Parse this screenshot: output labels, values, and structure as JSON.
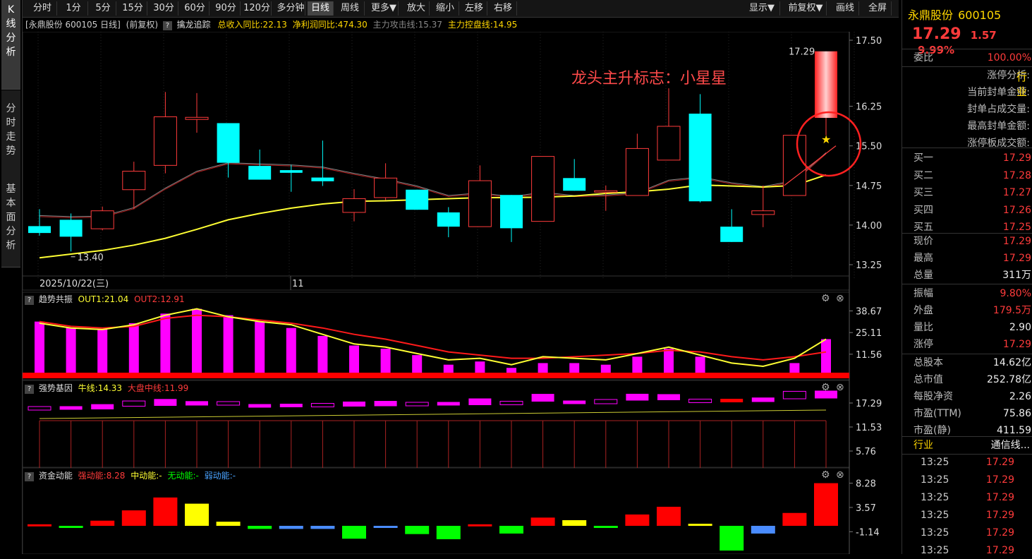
{
  "sidebar": {
    "tabs": [
      {
        "label": "K线分析",
        "chars": [
          "K",
          "线",
          "分",
          "析"
        ]
      },
      {
        "label": "分时走势",
        "chars": [
          "分",
          "时",
          "走",
          "势"
        ]
      },
      {
        "label": "基本面分析",
        "chars": [
          "基",
          "本",
          "面",
          "分",
          "析"
        ]
      }
    ]
  },
  "toolbar": {
    "periods": [
      "分时",
      "1分",
      "5分",
      "15分",
      "30分",
      "60分",
      "90分",
      "120分",
      "多分钟",
      "日线",
      "周线",
      "更多▼",
      "放大",
      "缩小",
      "左移",
      "右移"
    ],
    "selected": "日线",
    "right": [
      "显示▼",
      "前复权▼",
      "画线",
      "全屏"
    ]
  },
  "chart_header": {
    "stock": "[永鼎股份 600105 日线]",
    "adjust": "(前复权)",
    "indicator": "擒龙追踪",
    "revenue": "总收入同比:22.13",
    "profit": "净利润同比:474.30",
    "attack": "主力攻击线:15.37",
    "control": "主力控盘线:14.95"
  },
  "main_chart": {
    "y_ticks": [
      "17.50",
      "16.25",
      "15.50",
      "14.75",
      "14.00",
      "13.25"
    ],
    "last_price_label": "17.29",
    "low_label": "13.40",
    "date_label": "2025/10/22(三)",
    "month_label": "11",
    "annotation": "龙头主升标志：小星星",
    "candles": [
      {
        "o": 13.98,
        "c": 13.85,
        "h": 14.3,
        "l": 13.8
      },
      {
        "o": 14.1,
        "c": 13.78,
        "h": 14.22,
        "l": 13.5
      },
      {
        "o": 13.93,
        "c": 14.27,
        "h": 14.35,
        "l": 13.9
      },
      {
        "o": 14.67,
        "c": 15.02,
        "h": 15.2,
        "l": 14.3
      },
      {
        "o": 15.13,
        "c": 16.05,
        "h": 16.52,
        "l": 14.98
      },
      {
        "o": 16.0,
        "c": 16.04,
        "h": 16.5,
        "l": 15.75
      },
      {
        "o": 15.93,
        "c": 15.18,
        "h": 15.93,
        "l": 14.9
      },
      {
        "o": 15.12,
        "c": 14.86,
        "h": 15.43,
        "l": 14.86
      },
      {
        "o": 15.04,
        "c": 14.99,
        "h": 15.14,
        "l": 14.63
      },
      {
        "o": 14.9,
        "c": 14.83,
        "h": 15.6,
        "l": 14.74
      },
      {
        "o": 14.24,
        "c": 14.5,
        "h": 14.68,
        "l": 14.07
      },
      {
        "o": 14.52,
        "c": 14.89,
        "h": 15.17,
        "l": 14.47
      },
      {
        "o": 14.67,
        "c": 14.29,
        "h": 14.67,
        "l": 14.29
      },
      {
        "o": 14.24,
        "c": 13.97,
        "h": 14.34,
        "l": 13.77
      },
      {
        "o": 13.97,
        "c": 14.84,
        "h": 15.13,
        "l": 13.97
      },
      {
        "o": 14.57,
        "c": 13.94,
        "h": 14.57,
        "l": 13.68
      },
      {
        "o": 14.07,
        "c": 15.3,
        "h": 15.3,
        "l": 14.07
      },
      {
        "o": 14.89,
        "c": 14.65,
        "h": 15.25,
        "l": 14.65
      },
      {
        "o": 14.65,
        "c": 14.65,
        "h": 14.75,
        "l": 14.27
      },
      {
        "o": 14.56,
        "c": 15.45,
        "h": 15.73,
        "l": 14.56
      },
      {
        "o": 15.23,
        "c": 15.87,
        "h": 16.59,
        "l": 15.23
      },
      {
        "o": 16.11,
        "c": 14.45,
        "h": 16.48,
        "l": 14.43
      },
      {
        "o": 13.97,
        "c": 13.68,
        "h": 14.3,
        "l": 13.68
      },
      {
        "o": 14.2,
        "c": 14.27,
        "h": 14.75,
        "l": 13.96
      },
      {
        "o": 14.56,
        "c": 15.7,
        "h": 15.7,
        "l": 14.56
      },
      {
        "o": 16.03,
        "c": 17.29,
        "h": 17.29,
        "l": 15.7
      }
    ],
    "ma_fast": [
      14.18,
      14.16,
      14.17,
      14.33,
      14.7,
      15.02,
      15.18,
      15.16,
      15.14,
      15.1,
      14.98,
      14.87,
      14.74,
      14.56,
      14.61,
      14.54,
      14.62,
      14.56,
      14.57,
      14.61,
      14.85,
      14.91,
      14.8,
      14.73,
      14.84,
      15.37
    ],
    "ma_control": [
      13.38,
      13.45,
      13.52,
      13.62,
      13.75,
      13.92,
      14.1,
      14.22,
      14.32,
      14.4,
      14.45,
      14.46,
      14.48,
      14.5,
      14.52,
      14.52,
      14.53,
      14.55,
      14.6,
      14.63,
      14.68,
      14.76,
      14.74,
      14.72,
      14.75,
      14.95
    ]
  },
  "panel2": {
    "title": "趋势共振",
    "out1": "OUT1:21.04",
    "out2": "OUT2:12.91",
    "y_ticks": [
      "38.67",
      "25.11",
      "11.56"
    ],
    "bars": [
      32,
      28,
      27,
      31,
      37,
      40,
      36,
      32,
      28,
      23,
      17,
      15,
      11,
      5,
      7,
      3,
      6,
      6,
      5,
      10,
      15,
      10,
      0,
      0,
      6,
      21
    ],
    "out1_line": [
      31,
      28,
      27,
      30,
      36,
      40,
      35,
      32,
      30,
      24,
      18,
      16,
      12,
      8,
      9,
      5,
      10,
      9,
      8,
      12,
      16,
      11,
      6,
      4,
      9,
      21
    ],
    "out2_line": [
      32,
      29,
      28,
      29,
      34,
      36,
      35,
      33,
      31,
      28,
      24,
      21,
      17,
      13,
      11,
      9,
      9,
      10,
      11,
      12,
      14,
      13,
      10,
      8,
      10,
      13
    ]
  },
  "panel3": {
    "title": "强势基因",
    "niu": "牛线:14.33",
    "dapan": "大盘中线:11.99",
    "y_ticks": [
      "17.29",
      "11.53",
      "5.76"
    ]
  },
  "panel4": {
    "title": "资金动能",
    "strong": "强动能:8.28",
    "mid": "中动能:-",
    "none": "无动能:-",
    "weak": "弱动能:-",
    "y_ticks": [
      "8.28",
      "3.57",
      "-1.14"
    ],
    "bars": [
      {
        "v": 0.3,
        "c": "red"
      },
      {
        "v": -0.4,
        "c": "green"
      },
      {
        "v": 1.0,
        "c": "red"
      },
      {
        "v": 3.0,
        "c": "red"
      },
      {
        "v": 5.5,
        "c": "red"
      },
      {
        "v": 4.3,
        "c": "yellow"
      },
      {
        "v": 0.8,
        "c": "yellow"
      },
      {
        "v": -0.6,
        "c": "green"
      },
      {
        "v": -0.6,
        "c": "blue"
      },
      {
        "v": -0.6,
        "c": "blue"
      },
      {
        "v": -2.5,
        "c": "green"
      },
      {
        "v": -0.3,
        "c": "blue"
      },
      {
        "v": -1.6,
        "c": "green"
      },
      {
        "v": -2.6,
        "c": "green"
      },
      {
        "v": 0.3,
        "c": "red"
      },
      {
        "v": -1.5,
        "c": "green"
      },
      {
        "v": 1.6,
        "c": "red"
      },
      {
        "v": 1.1,
        "c": "yellow"
      },
      {
        "v": -0.3,
        "c": "green"
      },
      {
        "v": 2.2,
        "c": "red"
      },
      {
        "v": 3.7,
        "c": "red"
      },
      {
        "v": 0.4,
        "c": "yellow"
      },
      {
        "v": -4.8,
        "c": "green"
      },
      {
        "v": -1.5,
        "c": "blue"
      },
      {
        "v": 2.5,
        "c": "red"
      },
      {
        "v": 8.28,
        "c": "red"
      }
    ]
  },
  "quote": {
    "name": "永鼎股份",
    "code": "600105",
    "price": "17.29",
    "change": "1.57",
    "pct": "9.99%",
    "weibi_label": "委比",
    "weibi": "100.00%",
    "limit_rows": [
      "涨停分析:",
      "当前封单金额:",
      "封单占成交量:",
      "最高封单金额:",
      "涨停板成交额:"
    ],
    "limit_tail": "行业",
    "bids": [
      {
        "label": "买一",
        "value": "17.29"
      },
      {
        "label": "买二",
        "value": "17.28"
      },
      {
        "label": "买三",
        "value": "17.27"
      },
      {
        "label": "买四",
        "value": "17.26"
      },
      {
        "label": "买五",
        "value": "17.25"
      }
    ],
    "stats": [
      {
        "label": "现价",
        "value": "17.29",
        "color": "red"
      },
      {
        "label": "最高",
        "value": "17.29",
        "color": "red"
      },
      {
        "label": "总量",
        "value": "311万",
        "color": "white"
      },
      {
        "label": "振幅",
        "value": "9.80%",
        "color": "red"
      },
      {
        "label": "外盘",
        "value": "179.5万",
        "color": "red"
      },
      {
        "label": "量比",
        "value": "2.90",
        "color": "white"
      },
      {
        "label": "涨停",
        "value": "17.29",
        "color": "red"
      },
      {
        "label": "总股本",
        "value": "14.62亿",
        "color": "white"
      },
      {
        "label": "总市值",
        "value": "252.78亿",
        "color": "white"
      },
      {
        "label": "每股净资",
        "value": "2.26",
        "color": "white"
      },
      {
        "label": "市盈(TTM)",
        "value": "75.86",
        "color": "white"
      },
      {
        "label": "市盈(静)",
        "value": "411.59",
        "color": "white"
      }
    ],
    "industry_label": "行业",
    "industry": "通信线...",
    "ticks": [
      {
        "time": "13:25",
        "price": "17.29"
      },
      {
        "time": "13:25",
        "price": "17.29"
      },
      {
        "time": "13:25",
        "price": "17.29"
      },
      {
        "time": "13:25",
        "price": "17.29"
      },
      {
        "time": "13:25",
        "price": "17.29"
      },
      {
        "time": "13:25",
        "price": "17.29"
      }
    ]
  },
  "colors": {
    "up": "#ff3b3b",
    "down": "#00ffff",
    "ma_control": "#ffff33",
    "ma_fast": "#cc2222",
    "magenta": "#ff00ff"
  }
}
